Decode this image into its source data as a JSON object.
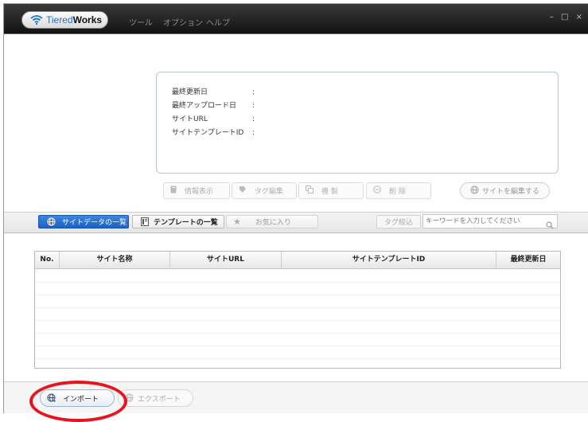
{
  "window": {
    "logo": {
      "tiered": "Tiered",
      "works": "Works"
    },
    "menu": [
      "ツール",
      "オプション",
      "ヘルプ"
    ],
    "controls": "– □ ×"
  },
  "info": {
    "rows": [
      {
        "label": "最終更新日",
        "colon": ":"
      },
      {
        "label": "最終アップロード日",
        "colon": ":"
      },
      {
        "label": "サイトURL",
        "colon": ":"
      },
      {
        "label": "サイトテンプレートID",
        "colon": ":"
      }
    ]
  },
  "actions": {
    "info": "情報表示",
    "tag_edit": "タグ編集",
    "copy": "複 製",
    "delete": "削 除",
    "edit_site": "サイトを編集する"
  },
  "tabs": {
    "site_list": "サイトデータの一覧",
    "template_list": "テンプレートの一覧",
    "favorites": "お気に入り"
  },
  "filter": {
    "tag_filter": "タグ絞込",
    "search_placeholder": "キーワードを入力してください"
  },
  "table": {
    "headers": [
      "No.",
      "サイト名称",
      "サイトURL",
      "サイトテンプレートID",
      "最終更新日"
    ]
  },
  "bottom": {
    "import": "インポート",
    "export": "エクスポート"
  },
  "colors": {
    "accent": "#1d5fc2",
    "highlight_circle": "#e8141c",
    "titlebar": "#1a1a1a"
  }
}
